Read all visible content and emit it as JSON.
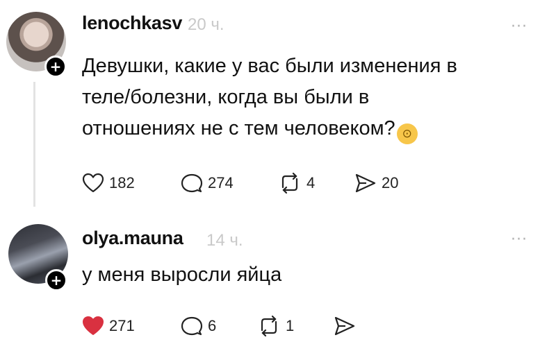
{
  "posts": [
    {
      "username": "lenochkasv",
      "time": "20 ч.",
      "more": "···",
      "text_lines": [
        "Девушки, какие у вас были изменения в",
        "теле/болезни, когда вы были в",
        "отношениях не с тем человеком?"
      ],
      "emoji": "🧐",
      "likes": "182",
      "comments": "274",
      "reposts": "4",
      "shares": "20",
      "liked": false
    },
    {
      "username": "olya.mauna",
      "time": "14 ч.",
      "more": "···",
      "text": "у меня выросли яйца",
      "likes": "271",
      "comments": "6",
      "reposts": "1",
      "shares": "",
      "liked": true
    }
  ],
  "colors": {
    "like_active": "#d93140",
    "icon": "#222222",
    "time": "#c9c9c9"
  }
}
